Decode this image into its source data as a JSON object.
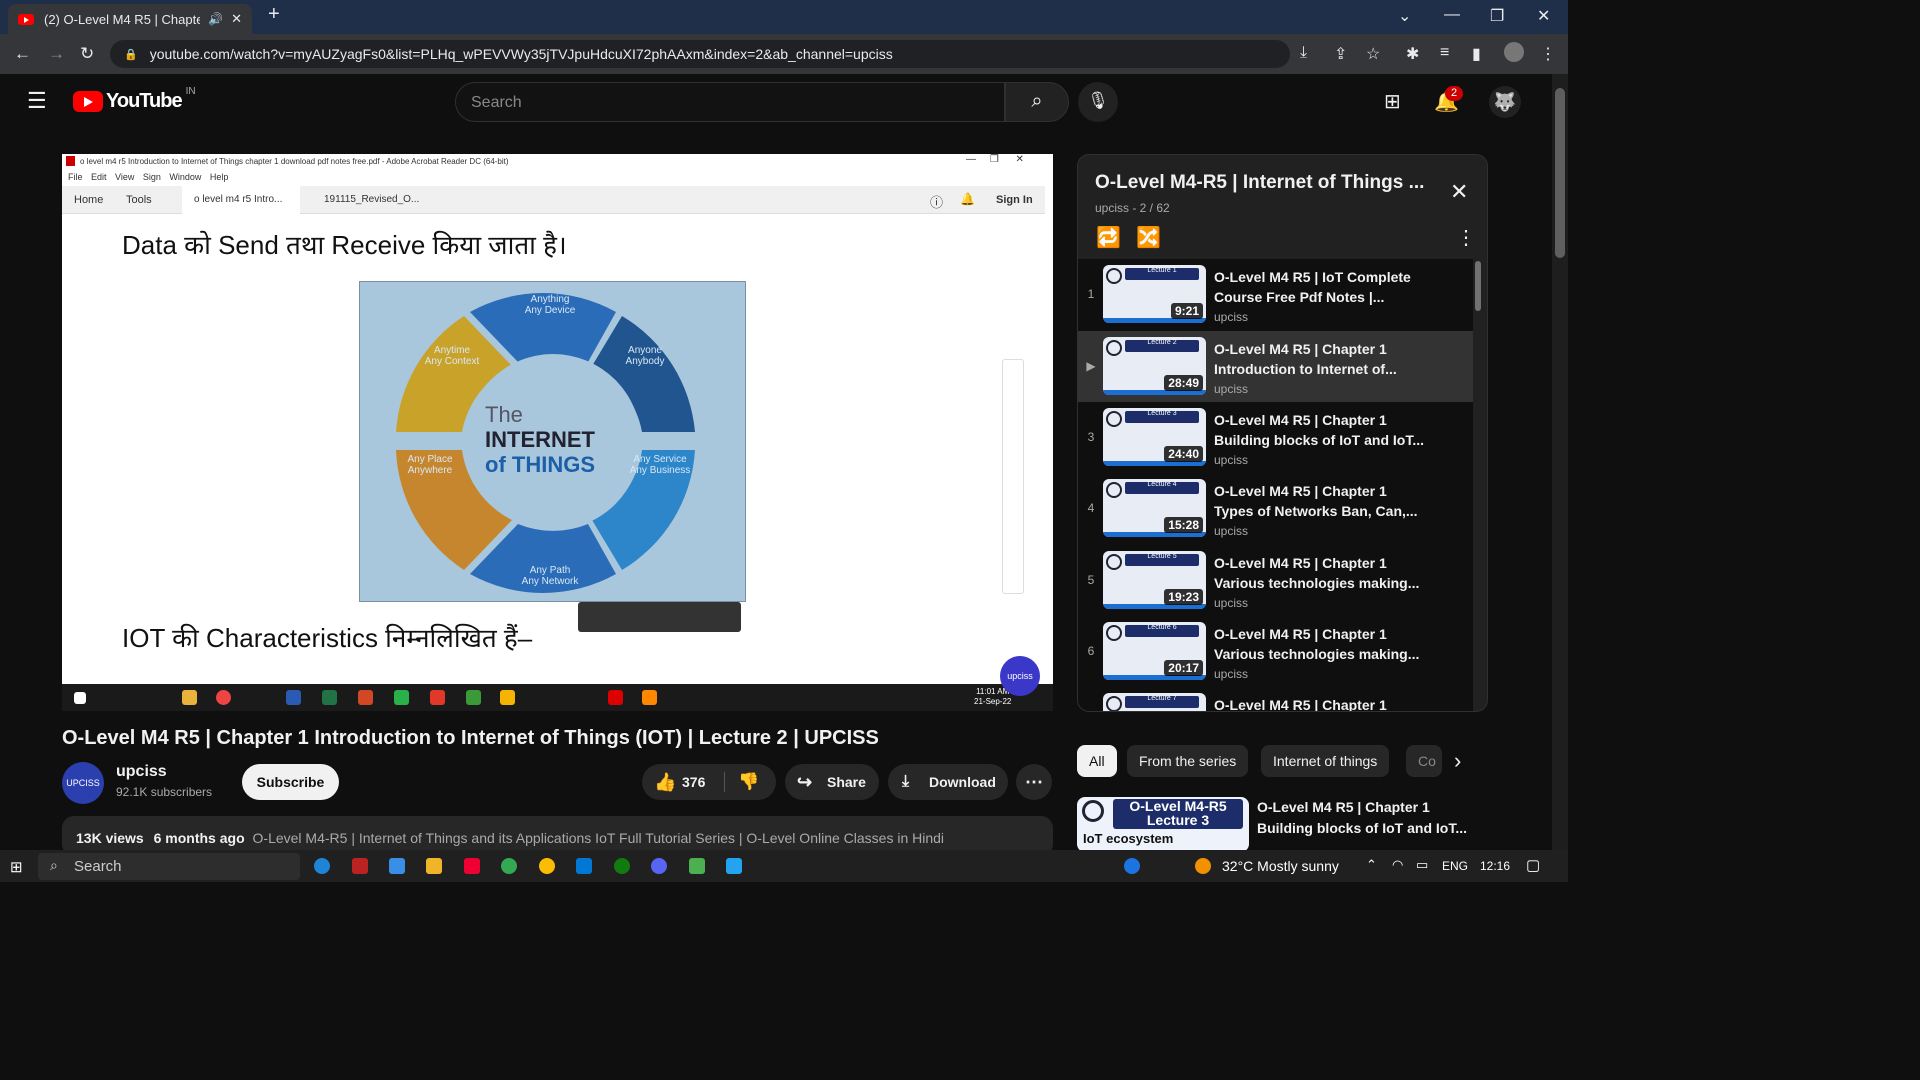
{
  "browser": {
    "tab_title": "(2) O-Level M4 R5 | Chapter",
    "url": "youtube.com/watch?v=myAUZyagFs0&list=PLHq_wPEVVWy35jTVJpuHdcuXI72phAAxm&index=2&ab_channel=upciss"
  },
  "youtube": {
    "logo_text": "YouTube",
    "region": "IN",
    "search_placeholder": "Search",
    "notification_count": "2"
  },
  "video_frame": {
    "acrobat_title": "o level m4 r5 Introduction to Internet of Things chapter 1 download pdf notes free.pdf - Adobe Acrobat Reader DC (64-bit)",
    "menu": "File  Edit  View  Sign  Window  Help",
    "tab_home": "Home",
    "tab_tools": "Tools",
    "tab_doc1": "o level m4 r5 Intro...",
    "tab_doc2": "191115_Revised_O...",
    "sign_in": "Sign In",
    "line1": "Data को  Send तथा  Receive किया  जाता  है।",
    "line2": "IOT की  Characteristics निम्नलिखित  हैं–",
    "iot_the": "The",
    "iot_internet": "INTERNET",
    "iot_of_things": "of THINGS",
    "seg_any_thing": "Anything\nAny Device",
    "seg_anyone": "Anyone\nAnybody",
    "seg_service": "Any Service\nAny Business",
    "seg_path": "Any Path\nAny Network",
    "seg_place": "Any Place\nAnywhere",
    "seg_time": "Anytime\nAny Context",
    "clock_time": "11:01 AM",
    "clock_date": "21-Sep-22"
  },
  "video": {
    "title": "O-Level M4 R5 | Chapter 1 Introduction to Internet of Things (IOT) | Lecture 2 | UPCISS",
    "channel": "upciss",
    "subscribers": "92.1K subscribers",
    "subscribe_label": "Subscribe",
    "likes": "376",
    "share_label": "Share",
    "download_label": "Download",
    "views": "13K views",
    "age": "6 months ago",
    "description": "O-Level M4-R5 | Internet of Things and its Applications IoT Full Tutorial Series | O-Level Online Classes in Hindi"
  },
  "playlist": {
    "title": "O-Level M4-R5 | Internet of Things ...",
    "subtitle": "upciss - 2 / 62",
    "items": [
      {
        "index": "1",
        "title": "O-Level M4 R5 | IoT Complete Course Free Pdf Notes |...",
        "channel": "upciss",
        "duration": "9:21",
        "lecture": "Lecture 1"
      },
      {
        "index": "▶",
        "title": "O-Level M4 R5 | Chapter 1 Introduction to Internet of...",
        "channel": "upciss",
        "duration": "28:49",
        "lecture": "Lecture 2"
      },
      {
        "index": "3",
        "title": "O-Level M4 R5 | Chapter 1 Building blocks of IoT and IoT...",
        "channel": "upciss",
        "duration": "24:40",
        "lecture": "Lecture 3"
      },
      {
        "index": "4",
        "title": "O-Level M4 R5 | Chapter 1 Types of Networks Ban, Can,...",
        "channel": "upciss",
        "duration": "15:28",
        "lecture": "Lecture 4"
      },
      {
        "index": "5",
        "title": "O-Level M4 R5 | Chapter 1 Various technologies making...",
        "channel": "upciss",
        "duration": "19:23",
        "lecture": "Lecture 5"
      },
      {
        "index": "6",
        "title": "O-Level M4 R5 | Chapter 1 Various technologies making...",
        "channel": "upciss",
        "duration": "20:17",
        "lecture": "Lecture 6"
      },
      {
        "index": "",
        "title": "O-Level M4 R5 | Chapter 1",
        "channel": "",
        "duration": "",
        "lecture": "Lecture 7"
      }
    ]
  },
  "chips": [
    "All",
    "From the series",
    "Internet of things",
    "Co"
  ],
  "recommendation": {
    "thumb_line1": "O-Level M4-R5",
    "thumb_line2": "Lecture 3",
    "thumb_line3": "IoT ecosystem",
    "title": "O-Level M4 R5 | Chapter 1 Building blocks of IoT and IoT..."
  },
  "taskbar": {
    "search": "Search",
    "weather": "32°C  Mostly sunny",
    "lang": "ENG",
    "time": "12:16"
  }
}
